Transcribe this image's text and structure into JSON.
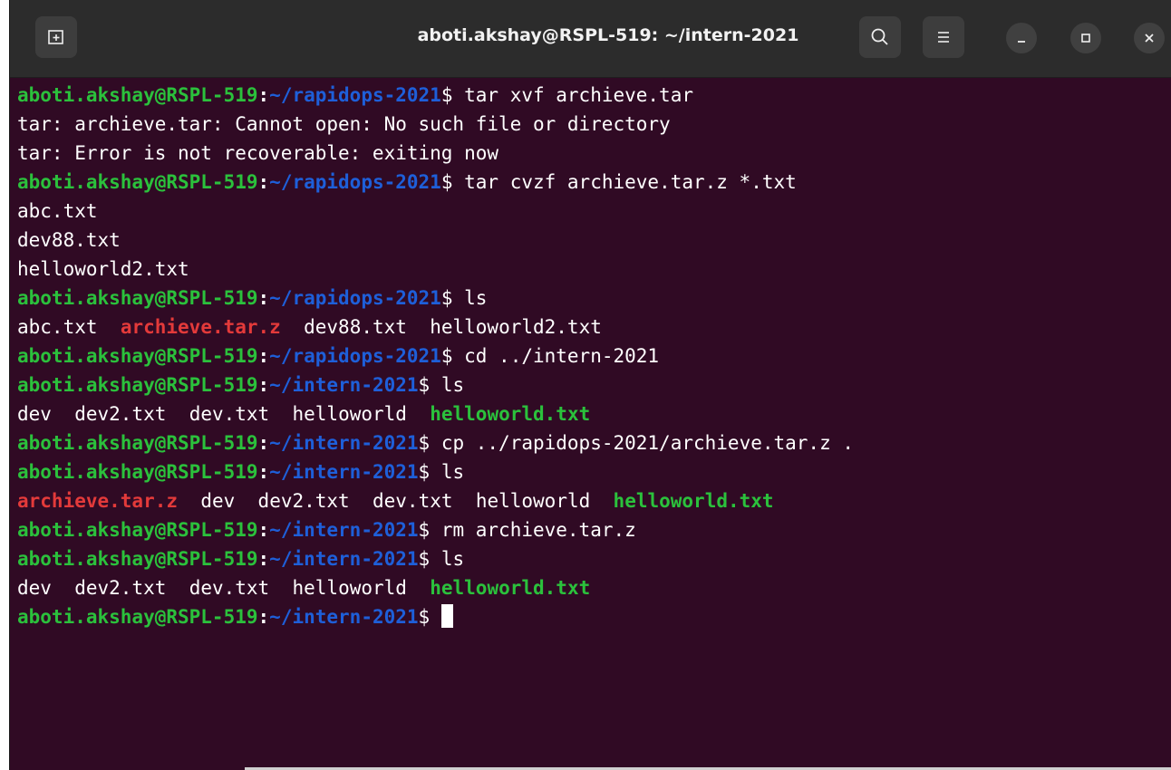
{
  "window": {
    "title": "aboti.akshay@RSPL-519: ~/intern-2021",
    "new_tab_icon": "new-tab-icon",
    "search_icon": "search-icon",
    "menu_icon": "hamburger-menu-icon",
    "minimize_icon": "minimize-icon",
    "maximize_icon": "maximize-icon",
    "close_icon": "close-icon"
  },
  "colors": {
    "background": "#300a24",
    "user": "#2bc13c",
    "path": "#1e5fd9",
    "archive": "#e33a3a",
    "executable": "#2bc13c"
  },
  "prompt_user": "aboti.akshay@RSPL-519",
  "lines": [
    {
      "kind": "prompt",
      "path": "~/rapidops-2021",
      "cmd": "tar xvf archieve.tar"
    },
    {
      "kind": "out",
      "text": "tar: archieve.tar: Cannot open: No such file or directory"
    },
    {
      "kind": "out",
      "text": "tar: Error is not recoverable: exiting now"
    },
    {
      "kind": "prompt",
      "path": "~/rapidops-2021",
      "cmd": "tar cvzf archieve.tar.z *.txt"
    },
    {
      "kind": "out",
      "text": "abc.txt"
    },
    {
      "kind": "out",
      "text": "dev88.txt"
    },
    {
      "kind": "out",
      "text": "helloworld2.txt"
    },
    {
      "kind": "prompt",
      "path": "~/rapidops-2021",
      "cmd": "ls"
    },
    {
      "kind": "ls",
      "items": [
        {
          "name": "abc.txt",
          "type": "file"
        },
        {
          "name": "archieve.tar.z",
          "type": "archive"
        },
        {
          "name": "dev88.txt",
          "type": "file"
        },
        {
          "name": "helloworld2.txt",
          "type": "file"
        }
      ]
    },
    {
      "kind": "prompt",
      "path": "~/rapidops-2021",
      "cmd": "cd ../intern-2021"
    },
    {
      "kind": "prompt",
      "path": "~/intern-2021",
      "cmd": "ls"
    },
    {
      "kind": "ls",
      "items": [
        {
          "name": "dev",
          "type": "file"
        },
        {
          "name": "dev2.txt",
          "type": "file"
        },
        {
          "name": "dev.txt",
          "type": "file"
        },
        {
          "name": "helloworld",
          "type": "file"
        },
        {
          "name": "helloworld.txt",
          "type": "exec"
        }
      ]
    },
    {
      "kind": "prompt",
      "path": "~/intern-2021",
      "cmd": "cp ../rapidops-2021/archieve.tar.z ."
    },
    {
      "kind": "prompt",
      "path": "~/intern-2021",
      "cmd": "ls"
    },
    {
      "kind": "ls",
      "items": [
        {
          "name": "archieve.tar.z",
          "type": "archive"
        },
        {
          "name": "dev",
          "type": "file"
        },
        {
          "name": "dev2.txt",
          "type": "file"
        },
        {
          "name": "dev.txt",
          "type": "file"
        },
        {
          "name": "helloworld",
          "type": "file"
        },
        {
          "name": "helloworld.txt",
          "type": "exec"
        }
      ]
    },
    {
      "kind": "prompt",
      "path": "~/intern-2021",
      "cmd": "rm archieve.tar.z"
    },
    {
      "kind": "prompt",
      "path": "~/intern-2021",
      "cmd": "ls"
    },
    {
      "kind": "ls",
      "items": [
        {
          "name": "dev",
          "type": "file"
        },
        {
          "name": "dev2.txt",
          "type": "file"
        },
        {
          "name": "dev.txt",
          "type": "file"
        },
        {
          "name": "helloworld",
          "type": "file"
        },
        {
          "name": "helloworld.txt",
          "type": "exec"
        }
      ]
    },
    {
      "kind": "prompt",
      "path": "~/intern-2021",
      "cmd": "",
      "cursor": true
    }
  ]
}
